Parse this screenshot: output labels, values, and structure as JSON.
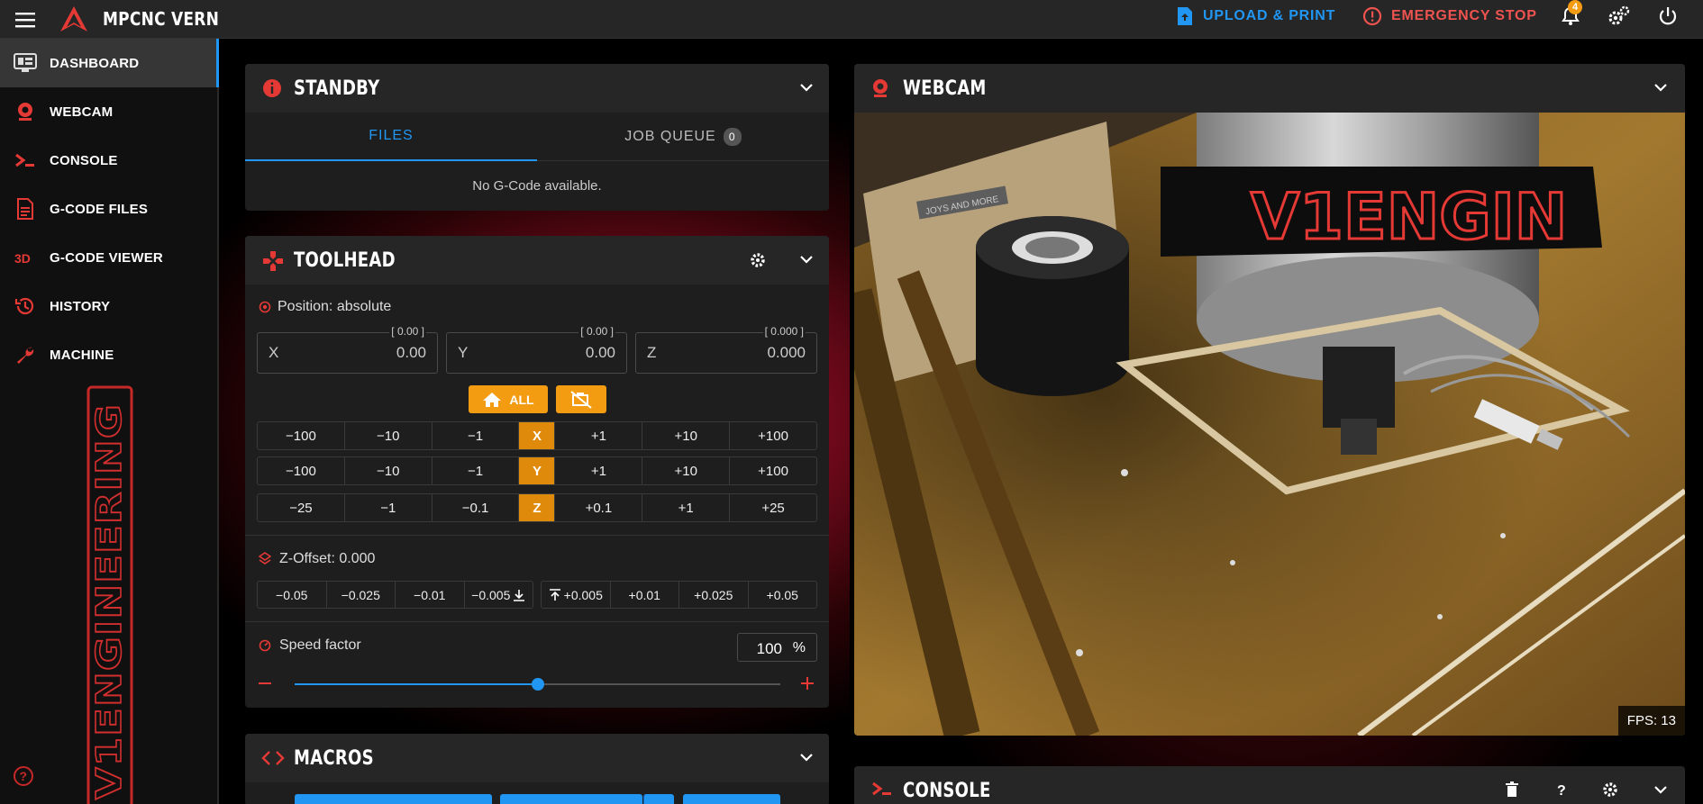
{
  "app": {
    "title": "MPCNC VERN",
    "upload_label": "UPLOAD & PRINT",
    "estop_label": "EMERGENCY STOP",
    "notification_count": "4"
  },
  "colors": {
    "accent": "#2196f3",
    "danger": "#e53935",
    "orange": "#e08a0c",
    "brand_red": "#d32f2f"
  },
  "sidebar": {
    "items": [
      {
        "label": "DASHBOARD",
        "icon": "monitor-dashboard-icon"
      },
      {
        "label": "WEBCAM",
        "icon": "webcam-icon"
      },
      {
        "label": "CONSOLE",
        "icon": "console-icon"
      },
      {
        "label": "G-CODE FILES",
        "icon": "file-document-icon"
      },
      {
        "label": "G-CODE VIEWER",
        "icon": "3d-icon"
      },
      {
        "label": "HISTORY",
        "icon": "history-icon"
      },
      {
        "label": "MACHINE",
        "icon": "wrench-icon"
      }
    ],
    "brand": "V1ENGINEERING"
  },
  "standby": {
    "title": "STANDBY",
    "tab_files": "FILES",
    "tab_queue": "JOB QUEUE",
    "queue_count": "0",
    "empty": "No G-Code available."
  },
  "toolhead": {
    "title": "TOOLHEAD",
    "position_label": "Position: absolute",
    "x": {
      "label": "X",
      "value": "0.00",
      "hint": "[ 0.00 ]"
    },
    "y": {
      "label": "Y",
      "value": "0.00",
      "hint": "[ 0.00 ]"
    },
    "z": {
      "label": "Z",
      "value": "0.000",
      "hint": "[ 0.000 ]"
    },
    "home_all": "ALL",
    "rows": [
      {
        "axis": "X",
        "neg": [
          "−100",
          "−10",
          "−1"
        ],
        "pos": [
          "+1",
          "+10",
          "+100"
        ]
      },
      {
        "axis": "Y",
        "neg": [
          "−100",
          "−10",
          "−1"
        ],
        "pos": [
          "+1",
          "+10",
          "+100"
        ]
      },
      {
        "axis": "Z",
        "neg": [
          "−25",
          "−1",
          "−0.1"
        ],
        "pos": [
          "+0.1",
          "+1",
          "+25"
        ]
      }
    ],
    "zoffset_label": "Z-Offset: 0.000",
    "zoffset_neg": [
      "−0.05",
      "−0.025",
      "−0.01",
      "−0.005"
    ],
    "zoffset_pos": [
      "+0.005",
      "+0.01",
      "+0.025",
      "+0.05"
    ],
    "speed_label": "Speed factor",
    "speed_value": "100",
    "speed_unit": "%",
    "speed_fraction": 0.5
  },
  "macros": {
    "title": "MACROS"
  },
  "webcam": {
    "title": "WEBCAM",
    "fps": "FPS: 13",
    "label_text": "V1ENGIN",
    "box_text": "JOYS AND MORE"
  },
  "console": {
    "title": "CONSOLE"
  }
}
